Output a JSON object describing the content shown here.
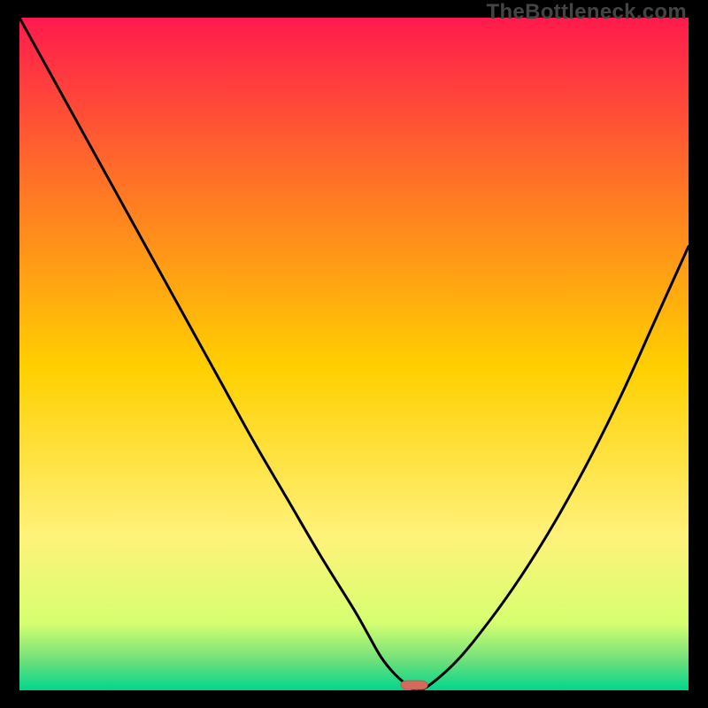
{
  "watermark": "TheBottleneck.com",
  "colors": {
    "top": "#ff1a4d",
    "mid1": "#ff6a2a",
    "mid2": "#ffd000",
    "mid3": "#fff27a",
    "lower": "#d6ff70",
    "green1": "#6fe07a",
    "green2": "#00d68c",
    "curve": "#000000",
    "marker_fill": "#d46a5e",
    "marker_stroke": "#c05a50",
    "frame": "#000000"
  },
  "chart_data": {
    "type": "line",
    "title": "",
    "xlabel": "",
    "ylabel": "",
    "xlim": [
      0,
      100
    ],
    "ylim": [
      0,
      100
    ],
    "series": [
      {
        "name": "bottleneck-curve",
        "x": [
          0,
          5,
          10,
          15,
          20,
          25,
          30,
          35,
          40,
          45,
          50,
          52,
          54,
          56,
          58,
          60,
          65,
          70,
          75,
          80,
          85,
          90,
          95,
          100
        ],
        "y": [
          100,
          91,
          82,
          73,
          64,
          55,
          46,
          37,
          28.5,
          20,
          12,
          8.5,
          5,
          2.5,
          0.8,
          0,
          4,
          10,
          17,
          25,
          34,
          44,
          55,
          66
        ]
      }
    ],
    "marker": {
      "x": 59,
      "y": 0,
      "w": 4,
      "h": 1.3
    }
  }
}
